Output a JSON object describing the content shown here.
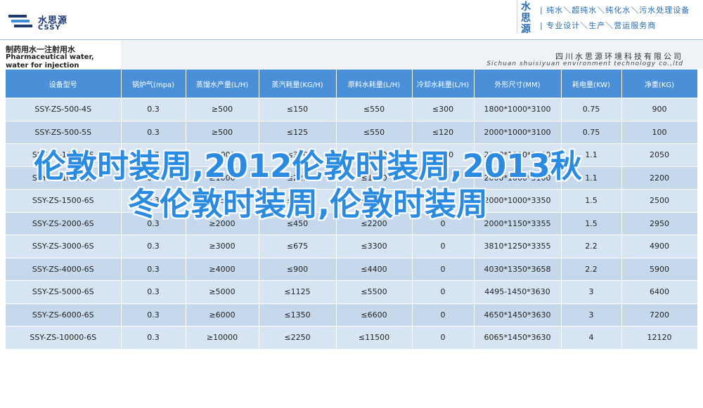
{
  "header": {
    "logo_cn": "水思源",
    "logo_en": "CSSY",
    "brand_big": "水思源",
    "brand_line1": "| 纯水＼超纯水＼纯化水＼污水处理设备",
    "brand_line2": "| 专业设计＼生产＼营运服务商",
    "accent": "#2a6db0"
  },
  "product": {
    "title_cn": "制药用水一注射用水",
    "title_en": "Pharmaceutical water, water for injection",
    "company_cn": "四川水思源环境科技有限公司",
    "company_en": "Sichuan shuisiyuan environment technology co.,ltd"
  },
  "table": {
    "headers": [
      "设备型号",
      "锅炉气(mpa)",
      "蒸馏水产量(L/H)",
      "蒸汽耗量(KG/H)",
      "原料水耗量(L/H)",
      "冷却水耗量(L/H)",
      "外形尺寸(MM)",
      "耗电量(KW)",
      "净重(KG)"
    ],
    "rows": [
      [
        "SSY-ZS-500-4S",
        "0.3",
        "≥500",
        "≤150",
        "≤550",
        "≤300",
        "1800*1000*3100",
        "0.75",
        "900"
      ],
      [
        "SSY-ZS-500-5S",
        "0.3",
        "≥500",
        "≤125",
        "≤550",
        "≤120",
        "2000*1000*3100",
        "0.75",
        "100"
      ],
      [
        "SSY-ZS-1000-4S",
        "0.3",
        "≥1000",
        "≤300",
        "≤1100",
        "≤600",
        "2000*1000*3100",
        "1.1",
        "2050"
      ],
      [
        "SSY-ZS-1000-6S",
        "0.3",
        "≥1000",
        "≤225",
        "≤1100",
        "0",
        "2000*1000*3100",
        "1.1",
        "2200"
      ],
      [
        "SSY-ZS-1500-6S",
        "0.3",
        "≥1500",
        "≤340",
        "≤1650",
        "0",
        "2000*1000*3350",
        "1.5",
        "2500"
      ],
      [
        "SSY-ZS-2000-6S",
        "0.3",
        "≥2000",
        "≤450",
        "≤2200",
        "0",
        "2000*1150*3355",
        "1.5",
        "2950"
      ],
      [
        "SSY-ZS-3000-6S",
        "0.3",
        "≥3000",
        "≤675",
        "≤3300",
        "0",
        "3810*1250*3355",
        "2.2",
        "4900"
      ],
      [
        "SSY-ZS-4000-6S",
        "0.3",
        "≥4000",
        "≤900",
        "≤4400",
        "0",
        "4030*1350*3658",
        "2.2",
        "5900"
      ],
      [
        "SSY-ZS-5000-6S",
        "0.3",
        "≥5000",
        "≤1125",
        "≤5500",
        "0",
        "4495-1450*3630",
        "3",
        "6400"
      ],
      [
        "SSY-ZS-6000-6S",
        "0.3",
        "≥6000",
        "≤1350",
        "≤6600",
        "0",
        "4650*1450*3630",
        "3",
        "7200"
      ],
      [
        "SSY-ZS-10000-6S",
        "0.3",
        "≥10000",
        "≤2250",
        "≤11500",
        "0",
        "6065*1450*3630",
        "4",
        "12120"
      ]
    ]
  },
  "overlay": {
    "text": "伦敦时装周,2012伦敦时装周,2013秋冬伦敦时装周,伦敦时装周",
    "color": "#2a8be0"
  }
}
